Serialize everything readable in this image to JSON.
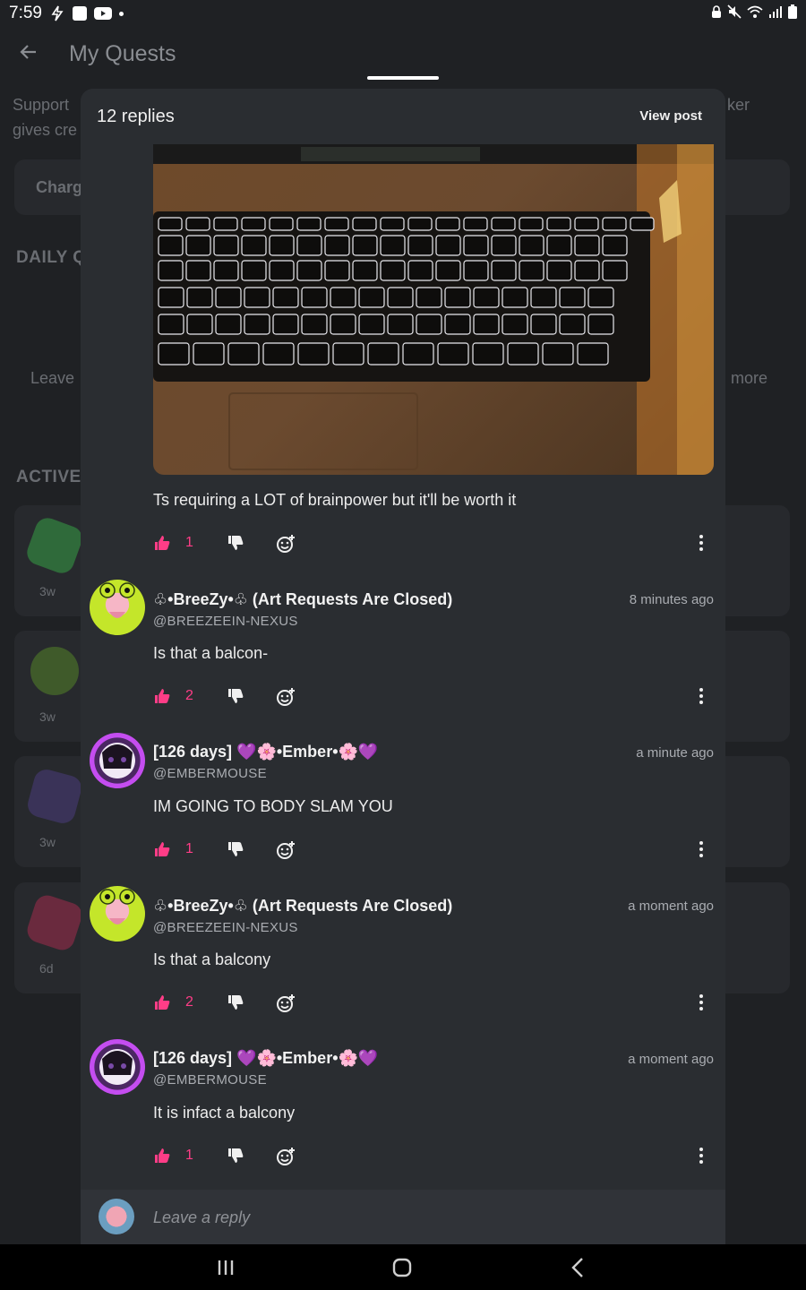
{
  "status_bar": {
    "time": "7:59"
  },
  "background": {
    "title": "My Quests",
    "support_text_1": "Support",
    "support_text_2": "gives cre",
    "right_text": "ker",
    "charge_button": "Charg",
    "daily_section": "DAILY QU",
    "leave_text": "Leave",
    "more_text": "more",
    "active_section": "ACTIVE Q",
    "quest_ages": [
      "3w",
      "3w",
      "3w",
      "6d"
    ]
  },
  "sheet": {
    "title": "12 replies",
    "view_post": "View post"
  },
  "post": {
    "text": "Ts requiring a LOT of brainpower but it'll be worth it",
    "likes": "1"
  },
  "comments": [
    {
      "author": "♧•BreeZy•♧ (Art Requests Are Closed)",
      "handle": "@BREEZEEIN-NEXUS",
      "time": "8 minutes ago",
      "text": "Is that a balcon-",
      "likes": "2",
      "avatar": "frog"
    },
    {
      "author": "[126 days] 💜🌸•Ember•🌸💜",
      "handle": "@EMBERMOUSE",
      "time": "a minute ago",
      "text": "IM GOING TO BODY SLAM YOU",
      "likes": "1",
      "avatar": "ember"
    },
    {
      "author": "♧•BreeZy•♧ (Art Requests Are Closed)",
      "handle": "@BREEZEEIN-NEXUS",
      "time": "a moment ago",
      "text": "Is that a balcony",
      "likes": "2",
      "avatar": "frog"
    },
    {
      "author": "[126 days] 💜🌸•Ember•🌸💜",
      "handle": "@EMBERMOUSE",
      "time": "a moment ago",
      "text": "It is infact a balcony",
      "likes": "1",
      "avatar": "ember"
    }
  ],
  "reply": {
    "placeholder": "Leave a reply"
  },
  "colors": {
    "accent_like": "#ff3d87",
    "sheet_bg": "#2a2d31",
    "page_bg": "#1f2124"
  }
}
